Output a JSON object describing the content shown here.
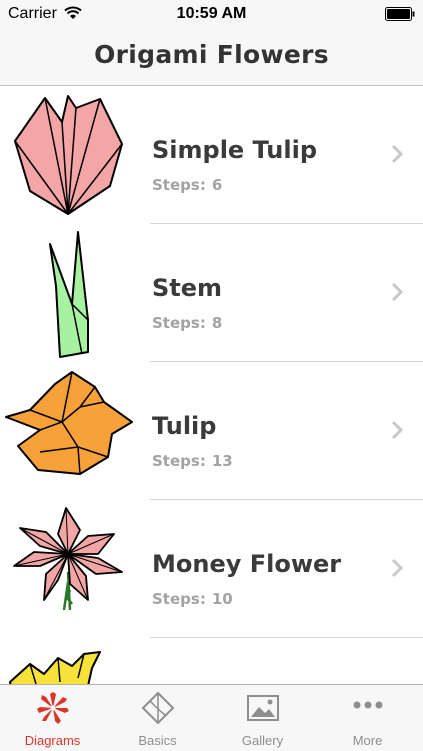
{
  "status_bar": {
    "carrier": "Carrier",
    "time": "10:59 AM"
  },
  "nav": {
    "title": "Origami Flowers"
  },
  "steps_label": "Steps:",
  "diagrams": [
    {
      "title": "Simple Tulip",
      "steps": "6",
      "color": "#f4a6a6"
    },
    {
      "title": "Stem",
      "steps": "8",
      "color": "#a6f2a0"
    },
    {
      "title": "Tulip",
      "steps": "13",
      "color": "#f7a13a"
    },
    {
      "title": "Money Flower",
      "steps": "10",
      "color": "#f2a6a6"
    },
    {
      "title": "",
      "steps": "",
      "color": "#f7e23a"
    }
  ],
  "tabs": [
    {
      "label": "Diagrams",
      "icon": "poinsettia-icon",
      "active": true
    },
    {
      "label": "Basics",
      "icon": "origami-square-icon",
      "active": false
    },
    {
      "label": "Gallery",
      "icon": "picture-icon",
      "active": false
    },
    {
      "label": "More",
      "icon": "more-dots-icon",
      "active": false
    }
  ],
  "colors": {
    "accent": "#d9372b",
    "inactive": "#8e8e8e"
  }
}
